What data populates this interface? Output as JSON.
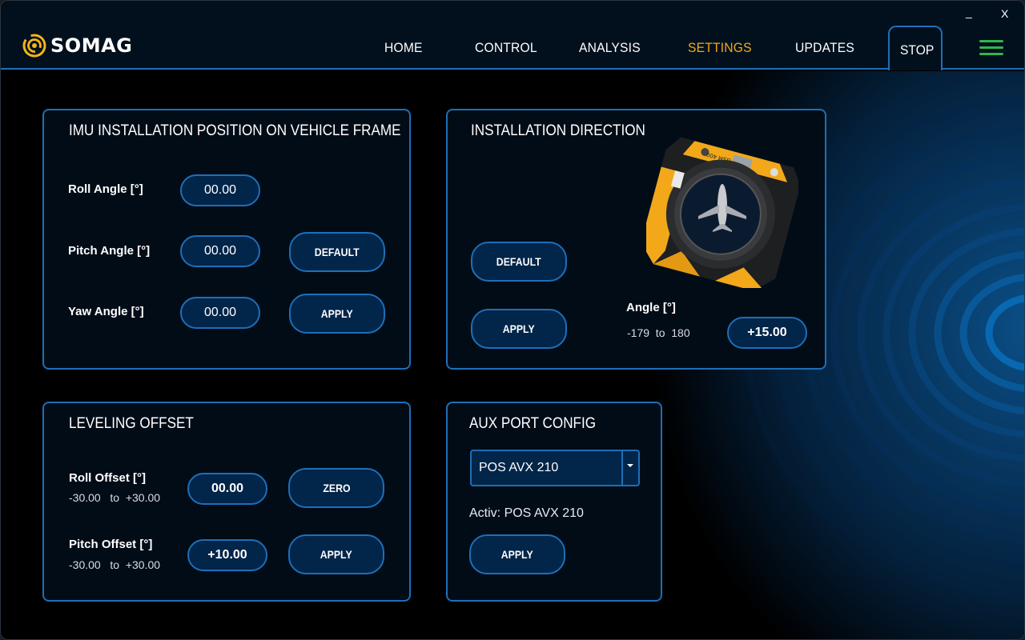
{
  "app": {
    "brand": "SOMAG",
    "window_controls": {
      "minimize": "_",
      "close": "X"
    }
  },
  "nav": {
    "items": [
      {
        "label": "HOME",
        "active": false
      },
      {
        "label": "CONTROL",
        "active": false
      },
      {
        "label": "ANALYSIS",
        "active": false
      },
      {
        "label": "SETTINGS",
        "active": true
      },
      {
        "label": "UPDATES",
        "active": false
      }
    ],
    "stop_label": "STOP",
    "menu_icon": "hamburger-menu-icon"
  },
  "colors": {
    "accent": "#f3a81d",
    "border": "#1d6fb8",
    "button_fill": "#02254a",
    "menu_green": "#2fb84d"
  },
  "imu_panel": {
    "title": "IMU INSTALLATION POSITION ON VEHICLE FRAME",
    "rows": [
      {
        "label": "Roll Angle [°]",
        "value": "00.00"
      },
      {
        "label": "Pitch Angle [°]",
        "value": "00.00"
      },
      {
        "label": "Yaw Angle [°]",
        "value": "00.00"
      }
    ],
    "default_label": "DEFAULT",
    "apply_label": "APPLY"
  },
  "direction_panel": {
    "title": "INSTALLATION DIRECTION",
    "default_label": "DEFAULT",
    "apply_label": "APPLY",
    "angle_label": "Angle [°]",
    "angle_range": "-179  to  180",
    "angle_value": "+15.00",
    "device_label": "GSM 400",
    "device_icon": "airplane-icon"
  },
  "leveling_panel": {
    "title": "LEVELING OFFSET",
    "rows": [
      {
        "label": "Roll Offset [°]",
        "range": "-30.00   to  +30.00",
        "value": "00.00"
      },
      {
        "label": "Pitch Offset [°]",
        "range": "-30.00   to  +30.00",
        "value": "+10.00"
      }
    ],
    "zero_label": "ZERO",
    "apply_label": "APPLY"
  },
  "aux_panel": {
    "title": "AUX PORT CONFIG",
    "selected": "POS AVX 210",
    "active_text": "Activ: POS AVX 210",
    "apply_label": "APPLY"
  }
}
